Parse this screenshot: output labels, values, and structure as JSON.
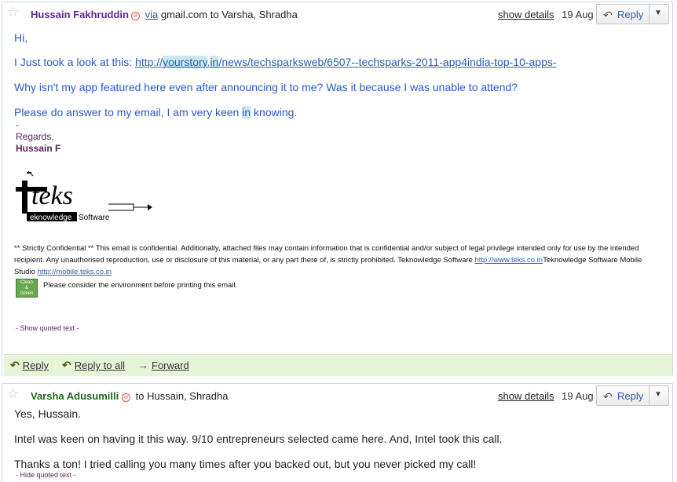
{
  "messages": [
    {
      "sender": "Hussain Fakhruddin",
      "via_label": "via",
      "via_domain": "gmail.com",
      "to_text": "to Varsha, Shradha",
      "show_details": "show details",
      "date": "19 Aug",
      "reply_label": "Reply",
      "body": {
        "greeting": "Hi,",
        "line1_prefix": "I Just took a look at this: ",
        "link_a": "http://",
        "link_b": "yourstory",
        "link_c": ".",
        "link_d": "in",
        "link_e": "/news/techsparksweb/6507--techsparks-2011-app4india-top-10-apps-",
        "line2": "Why isn't my app featured here even after announcing it to me? Was it because I was unable to attend?",
        "line3_a": "Please do answer to my email, I am very keen ",
        "line3_b": "in",
        "line3_c": " knowing.",
        "dash": "-",
        "regards": "Regards,",
        "signature_name": "Hussain F"
      },
      "logo": {
        "main": "teks",
        "sub": "eknowledge Software"
      },
      "legal": {
        "text1": "** Strictly Confidential ** This email is confidential. Additionally, attached files may contain information that is confidential and/or subject of legal privilege intended only for use by the intended recipient. Any unauthorised reproduction, use or disclosure of this material, or any part there of, is strictly prohibited. Teknowledge Software ",
        "link1": "http://www.teks.co.in",
        "text2": "Teknowledge Software Mobile Studio ",
        "link2": "http://mobile.teks.co.in"
      },
      "badge": {
        "l1": "Clean",
        "l2": "&",
        "l3": "Green"
      },
      "env_text": "Please consider the environment before printing this email.",
      "quoted_text": "- Show quoted text -",
      "footer": {
        "reply": "Reply",
        "reply_all": "Reply to all",
        "forward": "Forward"
      }
    },
    {
      "sender": "Varsha Adusumilli",
      "to_text": "to Hussain, Shradha",
      "show_details": "show details",
      "date": "19 Aug",
      "reply_label": "Reply",
      "body": {
        "line1": "Yes, Hussain.",
        "line2": "Intel was keen on having it this way. 9/10 entrepreneurs selected came here. And, Intel took this call.",
        "line3": "Thanks a ton! I tried calling you many times after you backed out, but you never picked my call!"
      },
      "quoted_text": "- Hide quoted text -"
    }
  ],
  "colors": {
    "body_text": "#2b5ac8",
    "link": "#2a5db0",
    "footer_bg": "#e6f4d8",
    "sender1": "#5b2b8e",
    "sender2": "#1e6a1e"
  }
}
